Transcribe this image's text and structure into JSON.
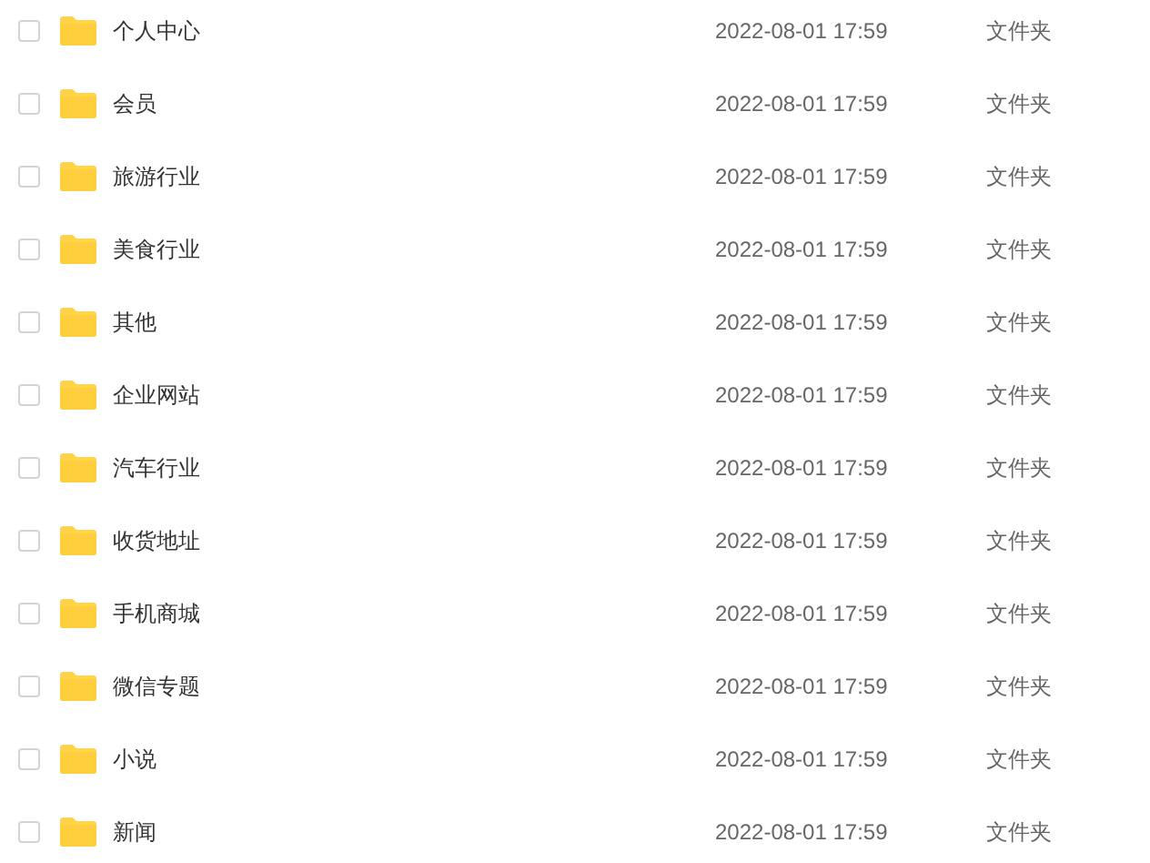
{
  "files": [
    {
      "name": "个人中心",
      "date": "2022-08-01 17:59",
      "type": "文件夹",
      "checked": false
    },
    {
      "name": "会员",
      "date": "2022-08-01 17:59",
      "type": "文件夹",
      "checked": false
    },
    {
      "name": "旅游行业",
      "date": "2022-08-01 17:59",
      "type": "文件夹",
      "checked": false
    },
    {
      "name": "美食行业",
      "date": "2022-08-01 17:59",
      "type": "文件夹",
      "checked": false
    },
    {
      "name": "其他",
      "date": "2022-08-01 17:59",
      "type": "文件夹",
      "checked": false
    },
    {
      "name": "企业网站",
      "date": "2022-08-01 17:59",
      "type": "文件夹",
      "checked": false
    },
    {
      "name": "汽车行业",
      "date": "2022-08-01 17:59",
      "type": "文件夹",
      "checked": false
    },
    {
      "name": "收货地址",
      "date": "2022-08-01 17:59",
      "type": "文件夹",
      "checked": false
    },
    {
      "name": "手机商城",
      "date": "2022-08-01 17:59",
      "type": "文件夹",
      "checked": false
    },
    {
      "name": "微信专题",
      "date": "2022-08-01 17:59",
      "type": "文件夹",
      "checked": false
    },
    {
      "name": "小说",
      "date": "2022-08-01 17:59",
      "type": "文件夹",
      "checked": false
    },
    {
      "name": "新闻",
      "date": "2022-08-01 17:59",
      "type": "文件夹",
      "checked": false
    }
  ]
}
